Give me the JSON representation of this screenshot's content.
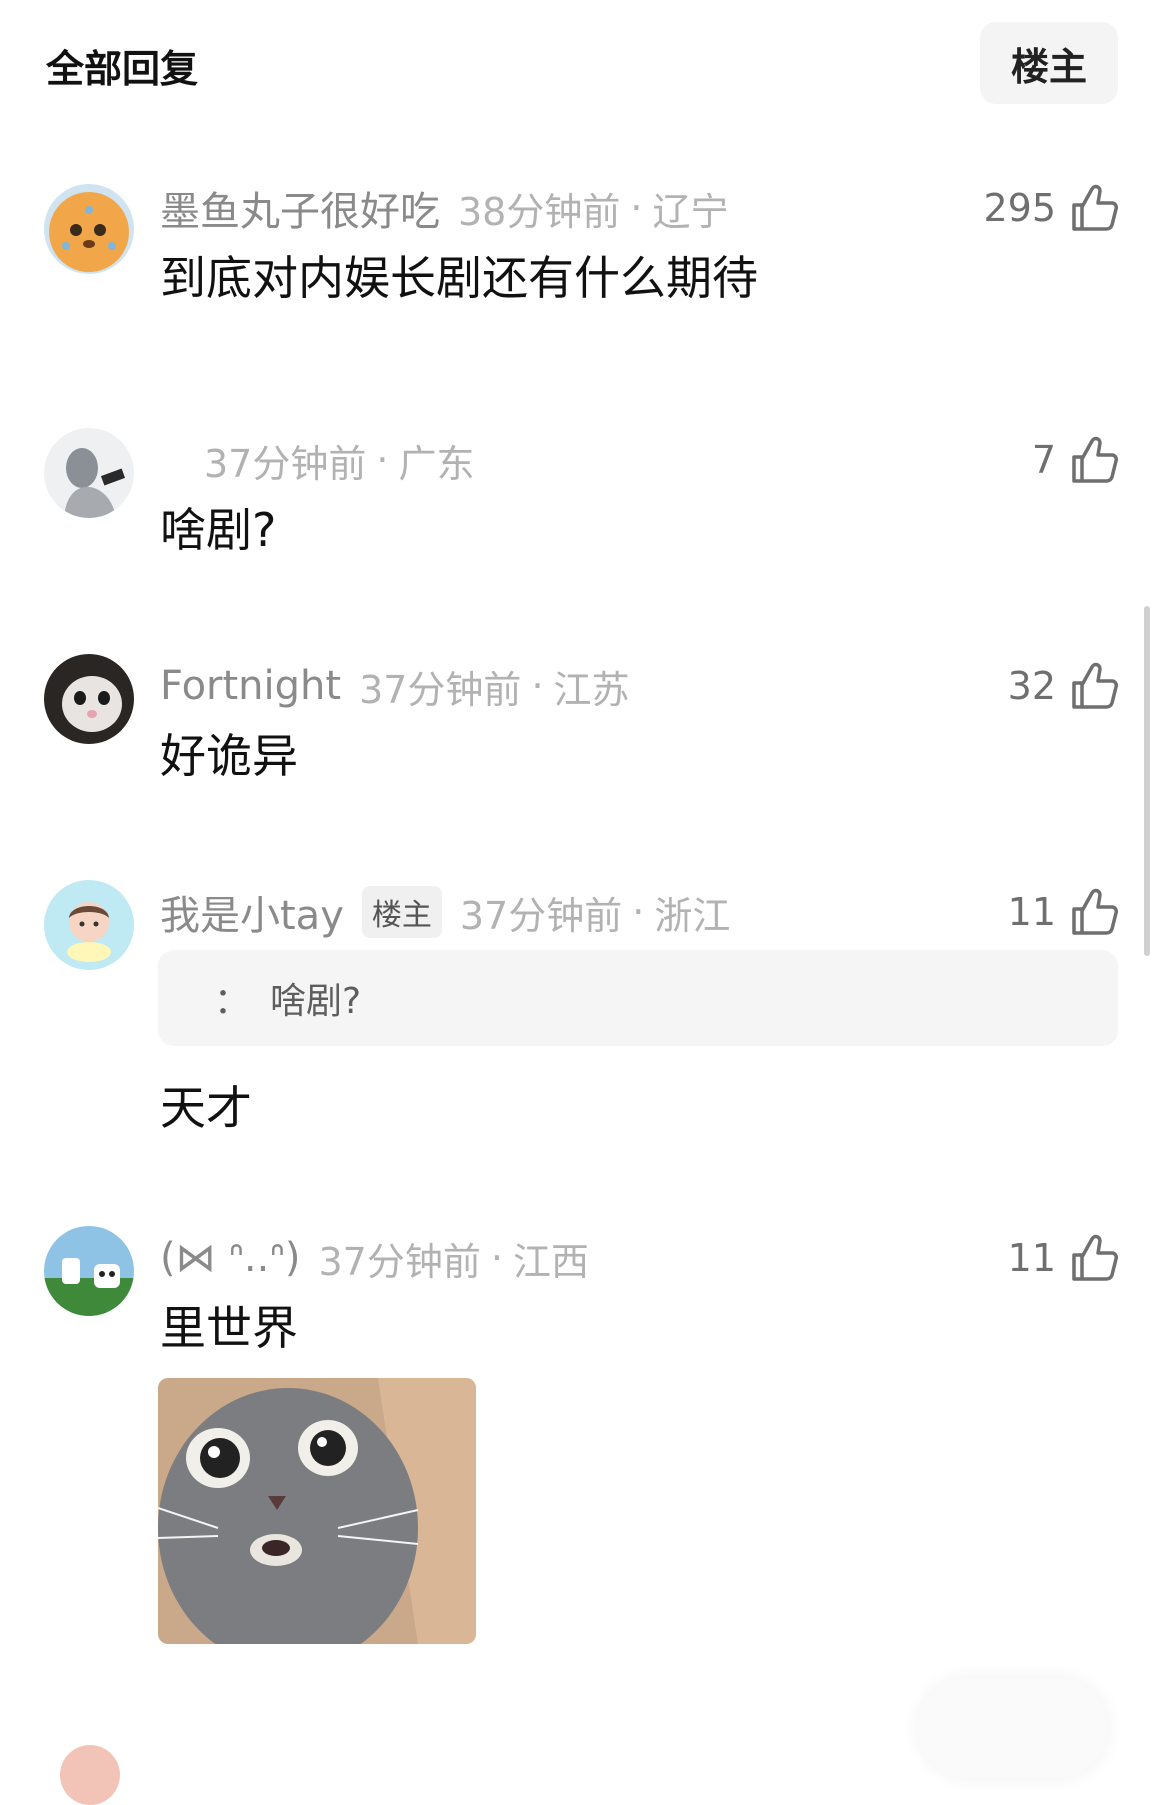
{
  "header": {
    "title": "全部回复",
    "op_button": "楼主"
  },
  "comments": [
    {
      "username": "墨鱼丸子很好吃",
      "time": "38分钟前",
      "sep": "·",
      "region": "辽宁",
      "likes": "295",
      "text": "到底对内娱长剧还有什么期待"
    },
    {
      "username": "",
      "time": "37分钟前",
      "sep": "·",
      "region": "广东",
      "likes": "7",
      "text": "啥剧?"
    },
    {
      "username": "Fortnight",
      "time": "37分钟前",
      "sep": "·",
      "region": "江苏",
      "likes": "32",
      "text": "好诡异"
    },
    {
      "username": "我是小tay",
      "badge": "楼主",
      "time": "37分钟前",
      "sep": "·",
      "region": "浙江",
      "likes": "11",
      "quote": {
        "colon": "：",
        "text": "啥剧?"
      },
      "text": "天才"
    },
    {
      "username": "(⋈ ᐢ..ᐢ)",
      "time": "37分钟前",
      "sep": "·",
      "region": "江西",
      "likes": "11",
      "text": "里世界"
    }
  ],
  "icons": {
    "like": "thumbs-up-icon"
  },
  "colors": {
    "username": "#8a8a8a",
    "meta": "#b2b2b2",
    "quote_bg": "#f5f5f5",
    "op_button_bg": "#f4f4f4"
  }
}
